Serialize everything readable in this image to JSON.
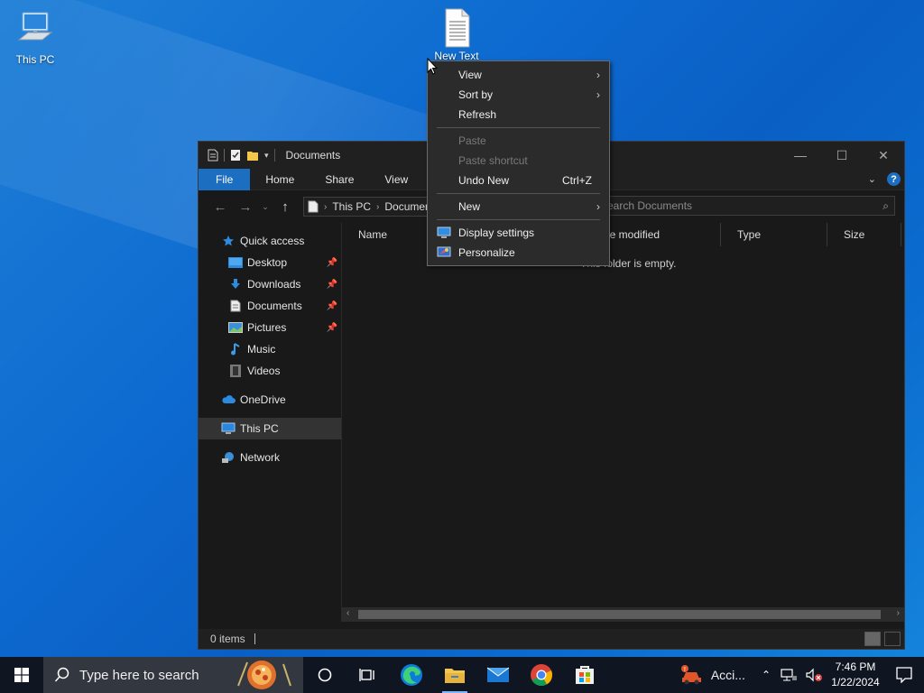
{
  "desktop": {
    "icons": [
      {
        "label": "This PC"
      },
      {
        "label": "New Text"
      }
    ]
  },
  "explorer": {
    "title": "Documents",
    "window_controls": {
      "minimize": "—",
      "maximize": "☐",
      "close": "✕"
    },
    "ribbon_tabs": [
      "File",
      "Home",
      "Share",
      "View"
    ],
    "address": {
      "segments": [
        "This PC",
        "Documents"
      ]
    },
    "search_placeholder": "Search Documents",
    "nav_pane": [
      {
        "label": "Quick access",
        "icon": "star-icon",
        "pinned": false
      },
      {
        "label": "Desktop",
        "icon": "desktop-folder-icon",
        "pinned": true
      },
      {
        "label": "Downloads",
        "icon": "downloads-folder-icon",
        "pinned": true
      },
      {
        "label": "Documents",
        "icon": "documents-folder-icon",
        "pinned": true
      },
      {
        "label": "Pictures",
        "icon": "pictures-folder-icon",
        "pinned": true
      },
      {
        "label": "Music",
        "icon": "music-folder-icon",
        "pinned": false
      },
      {
        "label": "Videos",
        "icon": "videos-folder-icon",
        "pinned": false
      },
      {
        "label": "OneDrive",
        "icon": "cloud-icon",
        "pinned": false
      },
      {
        "label": "This PC",
        "icon": "computer-icon",
        "pinned": false
      },
      {
        "label": "Network",
        "icon": "network-icon",
        "pinned": false
      }
    ],
    "columns": [
      "Name",
      "Date modified",
      "Type",
      "Size"
    ],
    "empty_message": "This folder is empty.",
    "status": "0 items"
  },
  "context_menu": {
    "items": [
      {
        "label": "View",
        "submenu": true,
        "disabled": false
      },
      {
        "label": "Sort by",
        "submenu": true,
        "disabled": false
      },
      {
        "label": "Refresh",
        "submenu": false,
        "disabled": false
      },
      {
        "label": "Paste",
        "submenu": false,
        "disabled": true
      },
      {
        "label": "Paste shortcut",
        "submenu": false,
        "disabled": true
      },
      {
        "label": "Undo New",
        "shortcut": "Ctrl+Z",
        "submenu": false,
        "disabled": false
      },
      {
        "label": "New",
        "submenu": true,
        "disabled": false
      },
      {
        "label": "Display settings",
        "icon": "display-icon",
        "submenu": false,
        "disabled": false
      },
      {
        "label": "Personalize",
        "icon": "personalize-icon",
        "submenu": false,
        "disabled": false
      }
    ]
  },
  "taskbar": {
    "search_placeholder": "Type here to search",
    "pinned_apps": [
      "cortana-icon",
      "task-view-icon",
      "edge-icon",
      "file-explorer-icon",
      "mail-icon",
      "chrome-icon",
      "store-icon"
    ],
    "tray_app_label": "Acci...",
    "time": "7:46 PM",
    "date": "1/22/2024"
  },
  "colors": {
    "accent": "#1c6fc0",
    "desktop_blue": "#0d6ad0",
    "explorer_bg": "#191919",
    "menu_bg": "#2b2b2b"
  }
}
